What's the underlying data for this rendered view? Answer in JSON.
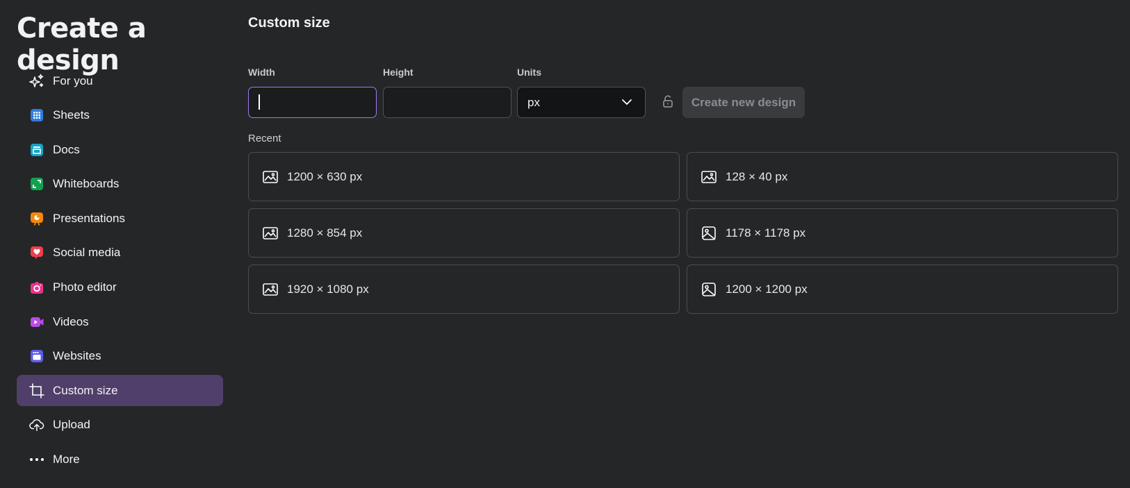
{
  "sidebar": {
    "title": "Create a design",
    "items": [
      {
        "label": "For you",
        "icon": "sparkles-icon",
        "color": "#ffffff",
        "active": false
      },
      {
        "label": "Sheets",
        "icon": "sheets-icon",
        "color": "#2f7dde",
        "active": false
      },
      {
        "label": "Docs",
        "icon": "docs-icon",
        "color": "#13a4c7",
        "active": false
      },
      {
        "label": "Whiteboards",
        "icon": "whiteboards-icon",
        "color": "#12a150",
        "active": false
      },
      {
        "label": "Presentations",
        "icon": "presentations-icon",
        "color": "#f5870d",
        "active": false
      },
      {
        "label": "Social media",
        "icon": "social-media-icon",
        "color": "#ef3f4c",
        "active": false
      },
      {
        "label": "Photo editor",
        "icon": "photo-editor-icon",
        "color": "#e8348d",
        "active": false
      },
      {
        "label": "Videos",
        "icon": "videos-icon",
        "color": "#b94be6",
        "active": false
      },
      {
        "label": "Websites",
        "icon": "websites-icon",
        "color": "#5b5be8",
        "active": false
      },
      {
        "label": "Custom size",
        "icon": "custom-size-icon",
        "color": "#ffffff",
        "active": true
      },
      {
        "label": "Upload",
        "icon": "upload-cloud-icon",
        "color": "#ffffff",
        "active": false
      },
      {
        "label": "More",
        "icon": "more-dots-icon",
        "color": "#ffffff",
        "active": false
      }
    ]
  },
  "main": {
    "title": "Custom size",
    "width_label": "Width",
    "height_label": "Height",
    "units_label": "Units",
    "width_value": "",
    "height_value": "",
    "units_value": "px",
    "create_button": "Create new design",
    "recent_label": "Recent",
    "recent": [
      {
        "label": "1200 × 630 px",
        "icon": "landscape-image-icon"
      },
      {
        "label": "128 × 40 px",
        "icon": "landscape-image-icon"
      },
      {
        "label": "1280 × 854 px",
        "icon": "landscape-image-icon"
      },
      {
        "label": "1178 × 1178 px",
        "icon": "square-image-icon"
      },
      {
        "label": "1920 × 1080 px",
        "icon": "landscape-image-icon"
      },
      {
        "label": "1200 × 1200 px",
        "icon": "square-image-icon"
      }
    ]
  },
  "colors": {
    "background": "#252628",
    "active_item": "#4f3f6a",
    "focus_border": "#9b7cf0"
  }
}
